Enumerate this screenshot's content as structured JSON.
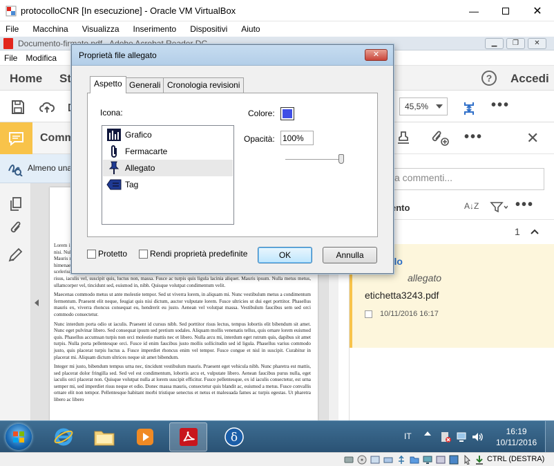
{
  "vbox": {
    "title": "protocolloCNR [In esecuzione] - Oracle VM VirtualBox",
    "menu": [
      "File",
      "Macchina",
      "Visualizza",
      "Inserimento",
      "Dispositivi",
      "Aiuto"
    ],
    "host_key": "CTRL (DESTRA)"
  },
  "reader": {
    "window_title": "Documento-firmato.pdf - Adobe Acrobat Reader DC",
    "menu": [
      "File",
      "Modifica"
    ],
    "tabs": {
      "home": "Home",
      "tools_partial": "St",
      "signin": "Accedi"
    },
    "zoom": "45,5%",
    "comment_label_partial": "Comm",
    "notice_partial": "Almeno una"
  },
  "document": {
    "paragraphs": [
      "Lorem ipsum dolor sit amet, consectetur adipiscing elit. Integer nec odio. Praesent libero. Sed cursus ante dapibus diam. Sed nisi. Nulla quis sem at nibh elementum imperdiet. Duis sagittis ipsum. Praesent mauris. Fusce nec tellus sed augue semper porta. Mauris massa. Vestibulum lacinia arcu eget nulla. Class aptent taciti sociosqu ad litora torquent per conubia nostra, per inceptos himenaeos. Curabitur sodales ligula in libero. Sed dignissim lacinia nunc. Curabitur tortor. Pellentesque nibh. Aenean quam. In scelerisque sem at dolor. Maecenas mattis. Sed convallis tristique sem. Proin ut ligula vel nunc egestas porttitor. Morbi lectus risus, iaculis vel, suscipit quis, luctus non, massa. Fusce ac turpis quis ligula lacinia aliquet. Mauris ipsum. Nulla metus metus, ullamcorper vel, tincidunt sed, euismod in, nibh. Quisque volutpat condimentum velit.",
      "Maecenas commodo metus ut ante molestie tempor. Sed ut viverra lorem, in aliquam mi. Nunc vestibulum metus a condimentum fermentum. Praesent elit neque, feugiat quis nisi dictum, auctor vulputate lorem. Fusce ultricies ut dui eget porttitor. Phasellus mauris ex, viverra rhoncus consequat eu, hendrerit eu justo. Aenean vel volutpat massa. Vestibulum faucibus sem sed orci commodo consectetur.",
      "Nunc interdum porta odio ut iaculis. Praesent id cursus nibh. Sed porttitor risus lectus, tempus lobortis elit bibendum sit amet. Nunc eget pulvinar libero. Sed consequat ipsum sed pretium sodales. Aliquam mollis venenatis tellus, quis ornare lorem euismod quis. Phasellus accumsan turpis non orci molestie mattis nec et libero. Nulla arcu mi, interdum eget rutrum quis, dapibus sit amet turpis. Nulla porta pellentesque orci. Fusce id enim faucibus justo mollis sollicitudin sed id ligula. Phasellus varius commodo justo, quis placerat turpis luctus a. Fusce imperdiet rhoncus enim vel tempor. Fusce congue et nisl in suscipit. Curabitur in placerat mi. Aliquam dictum ultrices neque sit amet bibendum.",
      "Integer mi justo, bibendum tempus urna nec, tincidunt vestibulum mauris. Praesent eget vehicula nibh. Nunc pharetra est mattis, sed placerat dolor fringilla sed. Sed vel est condimentum, lobortis arcu et, vulputate libero. Aenean faucibus purus nulla, eget iaculis orci placerat non. Quisque volutpat nulla at lorem suscipit efficitur. Fusce pellentesque, ex id iaculis consectetur, est urna semper mi, sed imperdiet risus neque et odio. Donec massa mauris, consectetur quis blandit ac, euismod a metus. Fusce convallis ornare elit non tempor. Pellentesque habitant morbi tristique senectus et netus et malesuada fames ac turpis egestas. Ut pharetra libero ac libero"
    ]
  },
  "comments_panel": {
    "search_partial": "a commenti...",
    "sort_partial": "ento",
    "count": "1",
    "card": {
      "title_partial": "ollo",
      "subtitle_partial": "allegato",
      "file": "etichetta3243.pdf",
      "date": "10/11/2016  16:17"
    }
  },
  "dialog": {
    "title": "Proprietà file allegato",
    "tabs": [
      "Aspetto",
      "Generali",
      "Cronologia revisioni"
    ],
    "icon_label": "Icona:",
    "icons": [
      {
        "label": "Grafico",
        "icon": "chart-icon"
      },
      {
        "label": "Fermacarte",
        "icon": "paperclip-icon"
      },
      {
        "label": "Allegato",
        "icon": "pushpin-icon"
      },
      {
        "label": "Tag",
        "icon": "tag-icon"
      }
    ],
    "selected_icon": "Allegato",
    "color_label": "Colore:",
    "color": "#3f4fe6",
    "opacity_label": "Opacità:",
    "opacity": "100%",
    "protected_label": "Protetto",
    "default_label": "Rendi proprietà predefinite",
    "ok": "OK",
    "cancel": "Annulla"
  },
  "taskbar": {
    "lang": "IT",
    "time": "16:19",
    "date": "10/11/2016"
  }
}
